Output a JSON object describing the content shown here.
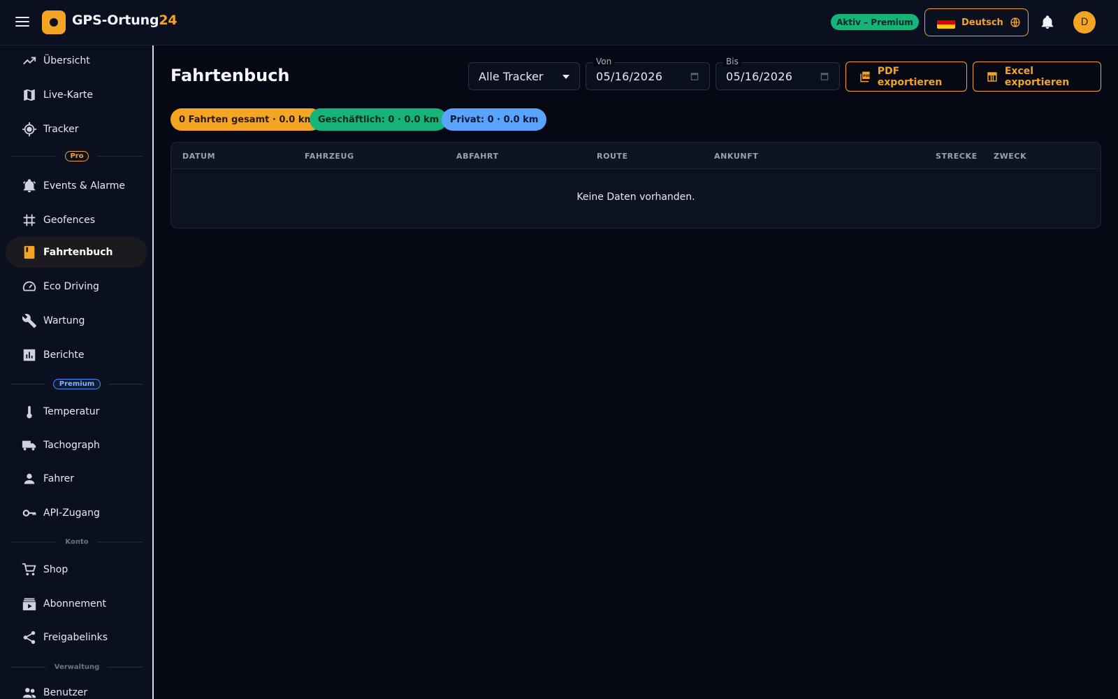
{
  "header": {
    "brand_main": "GPS-Ortung",
    "brand_accent": "24",
    "status": "Aktiv – Premium",
    "language": "Deutsch",
    "avatar_initial": "D"
  },
  "sidebar": {
    "items": [
      {
        "label": "Übersicht",
        "icon": "trending-up-icon"
      },
      {
        "label": "Live-Karte",
        "icon": "map-icon"
      },
      {
        "label": "Tracker",
        "icon": "gps-target-icon"
      },
      {
        "label": "Events & Alarme",
        "icon": "bell-alarm-icon"
      },
      {
        "label": "Geofences",
        "icon": "grid-fence-icon"
      },
      {
        "label": "Fahrtenbuch",
        "icon": "book-icon",
        "active": true
      },
      {
        "label": "Eco Driving",
        "icon": "speedometer-icon"
      },
      {
        "label": "Wartung",
        "icon": "wrench-icon"
      },
      {
        "label": "Berichte",
        "icon": "bar-chart-icon"
      },
      {
        "label": "Temperatur",
        "icon": "thermometer-icon"
      },
      {
        "label": "Tachograph",
        "icon": "truck-icon"
      },
      {
        "label": "Fahrer",
        "icon": "person-icon"
      },
      {
        "label": "API-Zugang",
        "icon": "key-icon"
      },
      {
        "label": "Shop",
        "icon": "cart-icon"
      },
      {
        "label": "Abonnement",
        "icon": "subscriptions-icon"
      },
      {
        "label": "Freigabelinks",
        "icon": "share-icon"
      },
      {
        "label": "Benutzer",
        "icon": "people-icon"
      }
    ],
    "sections": {
      "pro": "Pro",
      "premium": "Premium",
      "konto": "Konto",
      "verwaltung": "Verwaltung"
    }
  },
  "main": {
    "title": "Fahrtenbuch",
    "tracker_select": "Alle Tracker",
    "from_label": "Von",
    "from_value": "05/16/2026",
    "to_label": "Bis",
    "to_value": "05/16/2026",
    "pdf_button": "PDF exportieren",
    "excel_button": "Excel exportieren",
    "chips": {
      "total": "0 Fahrten gesamt · 0.0 km",
      "business": "Geschäftlich: 0 · 0.0 km",
      "private": "Privat: 0 · 0.0 km"
    },
    "table": {
      "columns": [
        "DATUM",
        "FAHRZEUG",
        "ABFAHRT",
        "ROUTE",
        "ANKUNFT",
        "STRECKE",
        "ZWECK"
      ],
      "rows": [],
      "empty_text": "Keine Daten vorhanden."
    }
  },
  "colors": {
    "accent": "#f5a524",
    "success": "#16b37a",
    "info": "#5aa3ff",
    "background": "#060913",
    "panel": "#0b1020"
  }
}
